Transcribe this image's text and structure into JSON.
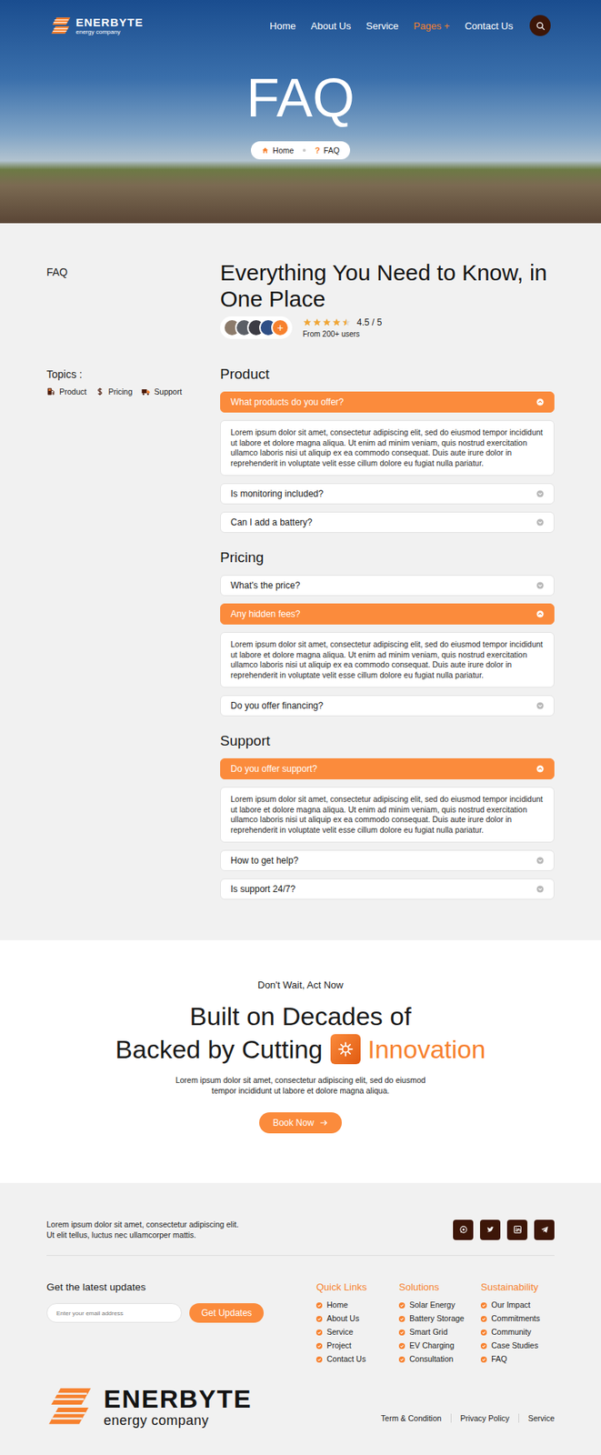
{
  "nav": {
    "logo": {
      "name": "ENERBYTE",
      "tagline": "energy company"
    },
    "items": [
      {
        "label": "Home",
        "selected": false
      },
      {
        "label": "About Us",
        "selected": false
      },
      {
        "label": "Service",
        "selected": false
      },
      {
        "label": "Pages +",
        "selected": true
      },
      {
        "label": "Contact Us",
        "selected": false
      }
    ]
  },
  "hero": {
    "title": "FAQ",
    "breadcrumb": [
      {
        "label": "Home",
        "mark": ""
      },
      {
        "label": "FAQ",
        "mark": "?"
      }
    ]
  },
  "intro": {
    "label": "FAQ",
    "title": "Everything You Need to Know, in One Place",
    "avatars": [
      {
        "color": "#8c7b6b"
      },
      {
        "color": "#5b5f66"
      },
      {
        "color": "#3c3c44"
      },
      {
        "color": "#2f4f86"
      }
    ],
    "more": "+",
    "rating": {
      "stars": 4.5,
      "score": "4.5 / 5",
      "caption": "From 200+ users"
    }
  },
  "topics": {
    "label": "Topics :",
    "items": [
      {
        "label": "Product"
      },
      {
        "label": "Pricing"
      },
      {
        "label": "Support"
      }
    ]
  },
  "sections": [
    {
      "title": "Product",
      "items": [
        {
          "question": "What products do you offer?",
          "expanded": true,
          "answer": "Lorem ipsum dolor sit amet, consectetur adipiscing elit, sed do eiusmod tempor incididunt ut labore et dolore magna aliqua. Ut enim ad minim veniam, quis nostrud exercitation ullamco laboris nisi ut aliquip ex ea commodo consequat. Duis aute irure dolor in reprehenderit in voluptate velit esse cillum dolore eu fugiat nulla pariatur."
        },
        {
          "question": "Is monitoring included?",
          "expanded": false,
          "answer": ""
        },
        {
          "question": "Can I add a battery?",
          "expanded": false,
          "answer": ""
        }
      ]
    },
    {
      "title": "Pricing",
      "items": [
        {
          "question": "What's the price?",
          "expanded": false,
          "answer": ""
        },
        {
          "question": "Any hidden fees?",
          "expanded": true,
          "answer": "Lorem ipsum dolor sit amet, consectetur adipiscing elit, sed do eiusmod tempor incididunt ut labore et dolore magna aliqua. Ut enim ad minim veniam, quis nostrud exercitation ullamco laboris nisi ut aliquip ex ea commodo consequat. Duis aute irure dolor in reprehenderit in voluptate velit esse cillum dolore eu fugiat nulla pariatur."
        },
        {
          "question": "Do you offer financing?",
          "expanded": false,
          "answer": ""
        }
      ]
    },
    {
      "title": "Support",
      "items": [
        {
          "question": "Do you offer support?",
          "expanded": true,
          "answer": "Lorem ipsum dolor sit amet, consectetur adipiscing elit, sed do eiusmod tempor incididunt ut labore et dolore magna aliqua. Ut enim ad minim veniam, quis nostrud exercitation ullamco laboris nisi ut aliquip ex ea commodo consequat. Duis aute irure dolor in reprehenderit in voluptate velit esse cillum dolore eu fugiat nulla pariatur."
        },
        {
          "question": "How to get help?",
          "expanded": false,
          "answer": ""
        },
        {
          "question": "Is support 24/7?",
          "expanded": false,
          "answer": ""
        }
      ]
    }
  ],
  "cta": {
    "eyebrow": "Don't Wait, Act Now",
    "line1": "Built on Decades of",
    "line2": "Backed by Cutting",
    "highlight": "Innovation",
    "text": "Lorem ipsum dolor sit amet, consectetur adipiscing elit, sed do eiusmod tempor incididunt ut labore et dolore magna aliqua.",
    "button": "Book Now"
  },
  "footer": {
    "text": "Lorem ipsum dolor sit amet, consectetur adipiscing elit. Ut elit tellus, luctus nec ullamcorper mattis.",
    "newsletter": {
      "title": "Get the latest updates",
      "placeholder": "Enter your email address",
      "button": "Get Updates"
    },
    "columns": [
      {
        "title": "Quick Links",
        "links": [
          "Home",
          "About Us",
          "Service",
          "Project",
          "Contact Us"
        ]
      },
      {
        "title": "Solutions",
        "links": [
          "Solar Energy",
          "Battery Storage",
          "Smart Grid",
          "EV Charging",
          "Consultation"
        ]
      },
      {
        "title": "Sustainability",
        "links": [
          "Our Impact",
          "Commitments",
          "Community",
          "Case Studies",
          "FAQ"
        ]
      }
    ],
    "logo": {
      "name": "ENERBYTE",
      "tagline": "energy company"
    },
    "legal": [
      "Term & Condition",
      "Privacy Policy",
      "Service"
    ]
  }
}
